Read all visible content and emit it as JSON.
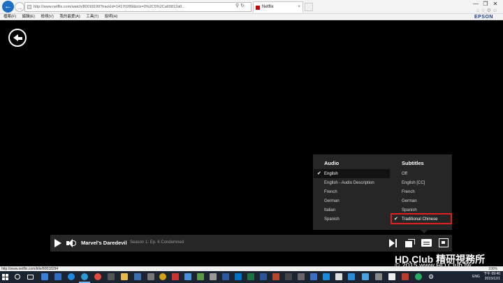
{
  "browser": {
    "address": "http://www.netflix.com/watch/80018199?trackId=14170289&tctx=0%2C5%2Ca65812a0...",
    "tab_label": "Netflix",
    "tab_close": "×",
    "window_controls": [
      "—",
      "❐",
      "✕"
    ],
    "menu": [
      "檔案(F)",
      "編輯(E)",
      "檢視(V)",
      "我的最愛(A)",
      "工具(T)",
      "說明(H)"
    ],
    "toolbar_brand": "EPSON"
  },
  "player": {
    "show_title": "Marvel's Daredevil",
    "episode_info": "Season 1: Ep. 6  Condemned"
  },
  "audio_menu": {
    "title": "Audio",
    "options": [
      "English",
      "English - Audio Description",
      "French",
      "German",
      "Italian",
      "Spanish"
    ],
    "selected_index": 0
  },
  "subtitles_menu": {
    "title": "Subtitles",
    "options": [
      "Off",
      "English [CC]",
      "French",
      "German",
      "Spanish",
      "Traditional Chinese"
    ],
    "selected_index": 5
  },
  "checkmark": "✔",
  "status_bar": {
    "url": "http://www.netflix.com/title/80018294",
    "zoom": "100%"
  },
  "taskbar": {
    "language": "ENG",
    "time": "下午 09:40",
    "date": "2015/12/1"
  },
  "watermark": {
    "line1": "HD.Club 精研視務所",
    "line2": "© 2015  www.HD.Club.tw"
  },
  "colors": {
    "highlight_border": "#e02020",
    "panel_bg": "#262626"
  }
}
